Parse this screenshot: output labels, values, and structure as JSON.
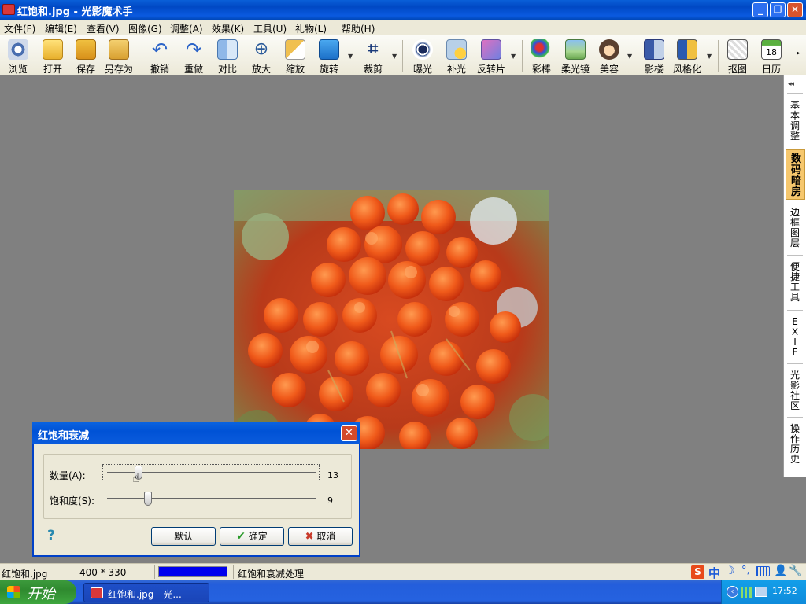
{
  "window": {
    "title": "红饱和.jpg - 光影魔术手"
  },
  "menu": [
    "文件(F)",
    "编辑(E)",
    "查看(V)",
    "图像(G)",
    "调整(A)",
    "效果(K)",
    "工具(U)",
    "礼物(L)",
    "帮助(H)"
  ],
  "toolbar": {
    "browse": "浏览",
    "open": "打开",
    "save": "保存",
    "save_as": "另存为",
    "undo": "撤销",
    "redo": "重做",
    "compare": "对比",
    "zoom_in": "放大",
    "resize": "缩放",
    "rotate": "旋转",
    "crop": "裁剪",
    "exposure": "曝光",
    "fill_light": "补光",
    "negative": "反转片",
    "color_wand": "彩棒",
    "soft_lens": "柔光镜",
    "beauty": "美容",
    "studio": "影楼",
    "stylize": "风格化",
    "cutout": "抠图",
    "calendar": "日历",
    "calendar_day": "18"
  },
  "right_panel": {
    "collapse": "◂◂",
    "tabs": [
      "基本调整",
      "数码暗房",
      "边框图层",
      "便捷工具",
      "EXIF",
      "光影社区",
      "操作历史"
    ],
    "active_index": 1
  },
  "dialog": {
    "title": "红饱和衰减",
    "amount_label": "数量(A):",
    "amount_value": "13",
    "saturation_label": "饱和度(S):",
    "saturation_value": "9",
    "default_button": "默认",
    "ok_button": "确定",
    "cancel_button": "取消",
    "help": "?",
    "close": "✕"
  },
  "slider_levels": {
    "amount": 0.15,
    "saturation": 0.195
  },
  "status": {
    "filename": "红饱和.jpg",
    "dimensions": "400 * 330",
    "progress": 1.0,
    "progress_color": "#0000ee",
    "message": "红饱和衰减处理"
  },
  "taskbar": {
    "start_label": "开始",
    "task_label": "红饱和.jpg - 光...",
    "ime_label": "中",
    "clock": "17:52"
  },
  "colors": {
    "title_blue": "#0054e3",
    "dialog_border": "#0041c8",
    "active_tab": "#f6c76d",
    "start_green": "#3c9a3c"
  }
}
